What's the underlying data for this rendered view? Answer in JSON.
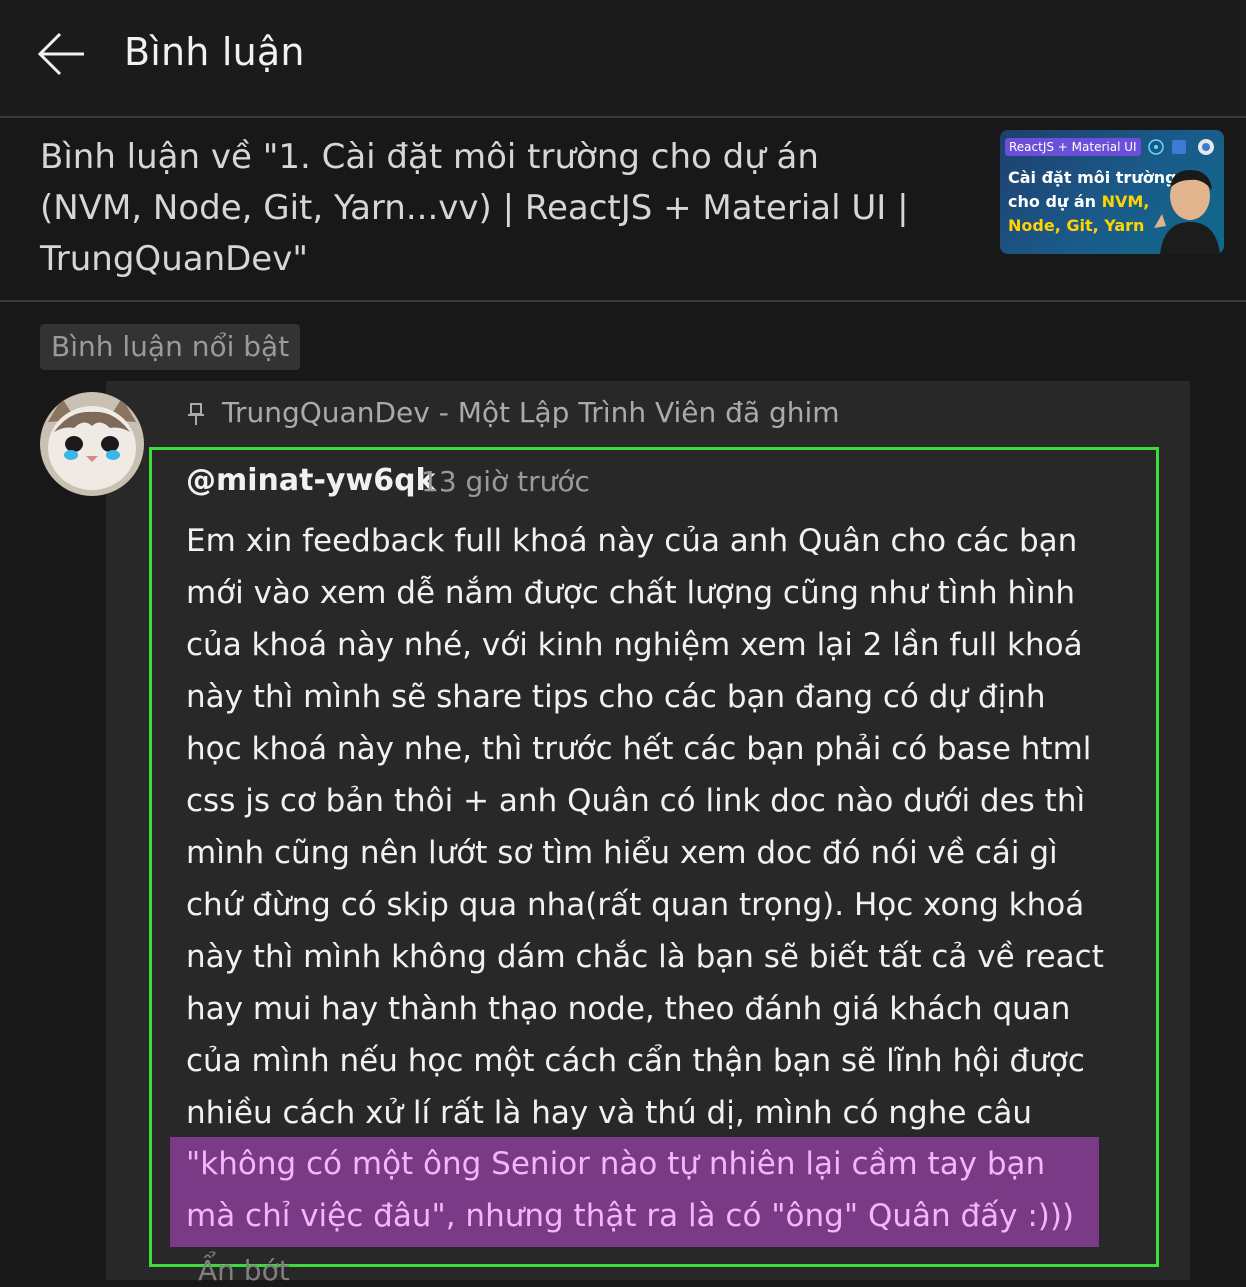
{
  "header": {
    "title": "Bình luận",
    "back_icon": "arrow-left-icon"
  },
  "video": {
    "title": "Bình luận về \"1. Cài đặt môi trường cho dự án (NVM, Node, Git, Yarn...vv) | ReactJS + Material UI | TrungQuanDev\"",
    "thumbnail": {
      "badge": "ReactJS + Material UI",
      "line1": "Cài đặt môi trường",
      "line2_prefix": "cho dự án ",
      "line2_highlight": "NVM,",
      "line3": "Node, Git, Yarn"
    }
  },
  "section": {
    "label": "Bình luận nổi bật"
  },
  "comment": {
    "pinned_by": "TrungQuanDev - Một Lập Trình Viên đã ghim",
    "author": "@minat-yw6qk",
    "time": "13 giờ trước",
    "body_lines": [
      "Em xin feedback full khoá này của anh Quân cho các bạn",
      "mới vào xem dễ nắm được chất lượng cũng như tình hình",
      "của khoá này nhé, với kinh nghiệm xem lại 2 lần full khoá",
      "này thì mình sẽ share tips cho các bạn đang có dự định",
      "học khoá này nhe, thì trước hết các bạn phải có base html",
      "css js cơ bản thôi + anh Quân có link doc nào dưới des thì",
      "mình cũng nên lướt sơ tìm hiểu xem doc đó nói về cái gì",
      "chứ đừng có skip qua nha(rất quan trọng). Học xong khoá",
      "này thì mình không dám chắc là bạn sẽ biết tất cả về react",
      "hay mui hay thành thạo node, theo đánh giá khách quan",
      "của mình nếu học một cách cẩn thận bạn sẽ lĩnh hội được",
      "nhiều cách xử lí rất là hay và thú dị, mình có nghe câu"
    ],
    "quote_lines": [
      "\"không có một ông Senior nào tự nhiên lại cầm tay bạn",
      "mà chỉ việc đâu\", nhưng thật ra là có \"ông\" Quân đấy :)))"
    ],
    "read_less": "Ẩn bớt"
  },
  "colors": {
    "background": "#181818",
    "card": "#282828",
    "highlight_border": "#3ddc3d",
    "quote_band": "#7a3a86",
    "quote_text": "#f3b6f6"
  }
}
